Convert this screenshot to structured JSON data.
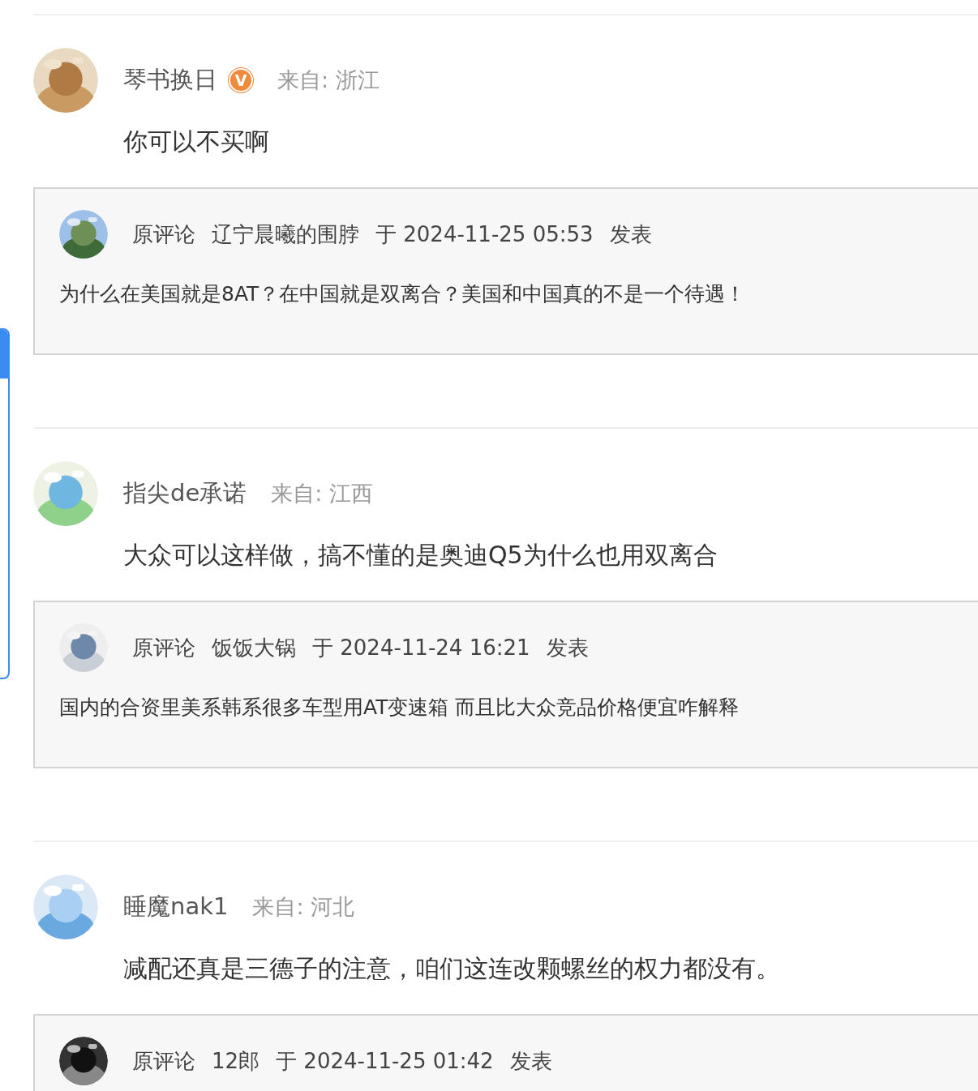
{
  "comments": [
    {
      "user": "琴书换日",
      "badge": "V",
      "location": "来自: 浙江",
      "text": "你可以不买啊",
      "quote": {
        "label": "原评论",
        "user": "辽宁晨曦的围脖",
        "time": "于 2024-11-25 05:53",
        "action": "发表",
        "text": "为什么在美国就是8AT？在中国就是双离合？美国和中国真的不是一个待遇！"
      }
    },
    {
      "user": "指尖de承诺",
      "location": "来自: 江西",
      "text": "大众可以这样做，搞不懂的是奥迪Q5为什么也用双离合",
      "quote": {
        "label": "原评论",
        "user": "饭饭大锅",
        "time": "于 2024-11-24 16:21",
        "action": "发表",
        "text": "国内的合资里美系韩系很多车型用AT变速箱 而且比大众竞品价格便宜咋解释"
      }
    },
    {
      "user": "睡魔nak1",
      "location": "来自: 河北",
      "text": "减配还真是三德子的注意，咱们这连改颗螺丝的权力都没有。",
      "quote": {
        "label": "原评论",
        "user": "12郎",
        "time": "于 2024-11-25 01:42",
        "action": "发表"
      }
    }
  ]
}
